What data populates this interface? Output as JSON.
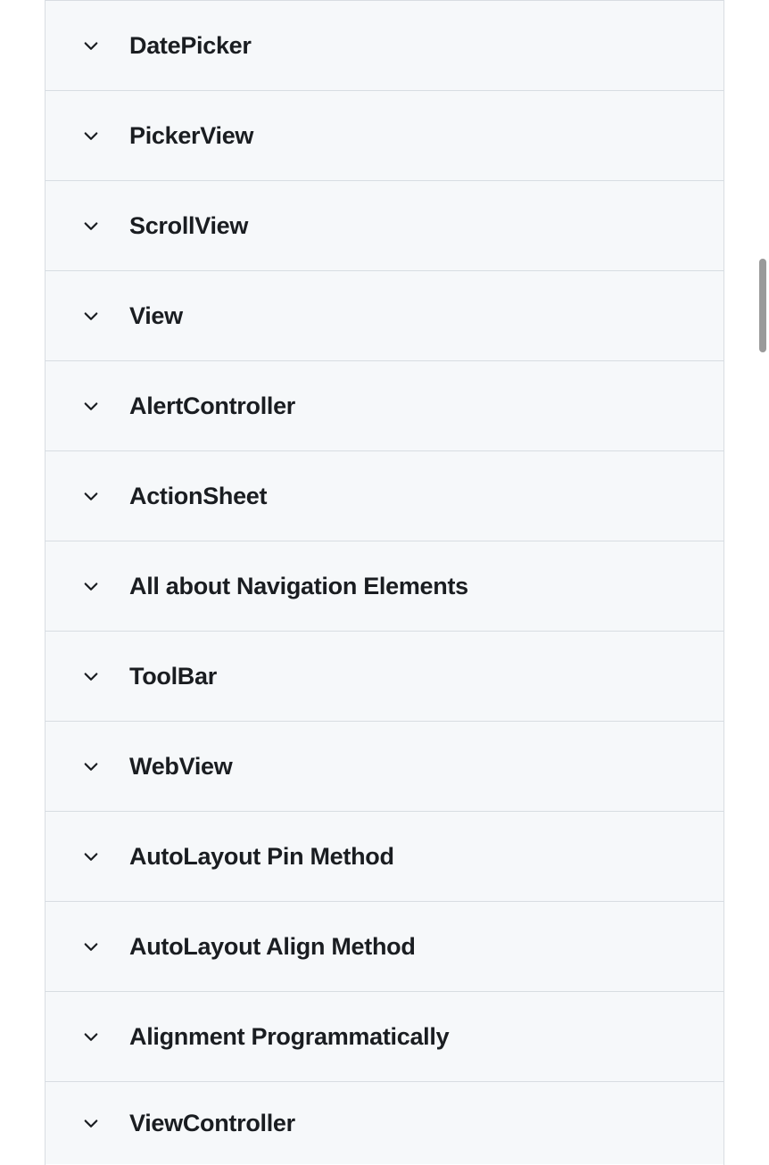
{
  "accordion": {
    "items": [
      {
        "label": "DatePicker"
      },
      {
        "label": "PickerView"
      },
      {
        "label": "ScrollView"
      },
      {
        "label": "View"
      },
      {
        "label": "AlertController"
      },
      {
        "label": "ActionSheet"
      },
      {
        "label": "All about Navigation Elements"
      },
      {
        "label": "ToolBar"
      },
      {
        "label": "WebView"
      },
      {
        "label": "AutoLayout Pin Method"
      },
      {
        "label": "AutoLayout Align Method"
      },
      {
        "label": "Alignment Programmatically"
      },
      {
        "label": "ViewController"
      }
    ]
  }
}
